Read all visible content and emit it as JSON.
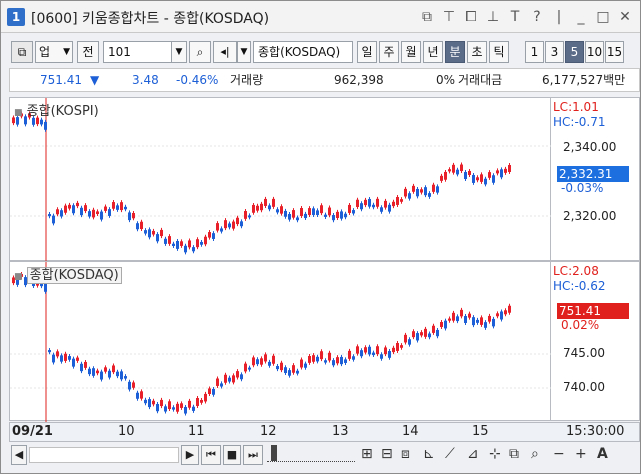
{
  "window": {
    "badge": "1",
    "title": "[0600] 키움종합차트 - 종합(KOSDAQ)",
    "tools": [
      {
        "glyph": "⧉",
        "icon": "detach-icon"
      },
      {
        "glyph": "⊤",
        "icon": "pin-top-icon"
      },
      {
        "glyph": "⧠",
        "icon": "window-icon"
      },
      {
        "glyph": "⊥",
        "icon": "pin-icon"
      },
      {
        "glyph": "T",
        "icon": "text-icon"
      },
      {
        "glyph": "?",
        "icon": "help-icon"
      },
      {
        "glyph": "|",
        "icon": "separator-icon"
      },
      {
        "glyph": "_",
        "icon": "minimize-icon"
      },
      {
        "glyph": "□",
        "icon": "maximize-icon"
      },
      {
        "glyph": "✕",
        "icon": "close-icon"
      }
    ]
  },
  "toolbar": {
    "market": "업",
    "period_type": "전",
    "code": "101",
    "name": "종합(KOSDAQ)",
    "periods": [
      "일",
      "주",
      "월",
      "년",
      "분",
      "초",
      "틱"
    ],
    "active_period": "분",
    "intervals": [
      "1",
      "3",
      "5",
      "10",
      "15"
    ],
    "active_interval": "5"
  },
  "quote": {
    "price": "751.41",
    "arrow": "▼",
    "change": "3.48",
    "pct": "-0.46%",
    "volume_label": "거래량",
    "volume": "962,398",
    "volume_pct": "0%",
    "amount_label": "거래대금",
    "amount": "6,177,527백만"
  },
  "panes": {
    "top": {
      "label": "종합(KOSPI)",
      "lc": "LC:1.01",
      "hc": "HC:-0.71",
      "ticks": [
        "2,340.00",
        "2,320.00"
      ],
      "current": "2,332.31",
      "current_pct": "-0.03%"
    },
    "bottom": {
      "label": "종합(KOSDAQ)",
      "lc": "LC:2.08",
      "hc": "HC:-0.62",
      "ticks": [
        "745.00",
        "740.00"
      ],
      "current": "751.41",
      "current_pct": "0.02%"
    }
  },
  "dates": [
    "09/21",
    "10",
    "11",
    "12",
    "13",
    "14",
    "15",
    "15:30:00"
  ],
  "colors": {
    "up": "#e8202a",
    "down": "#1d5fd6",
    "current_top": "#1d6fe0",
    "current_bottom": "#e0201c"
  },
  "bottom_controls": [
    "◀",
    "▶",
    "⏮",
    "■",
    "⏭",
    "🔍",
    "−",
    "+",
    "A"
  ]
}
